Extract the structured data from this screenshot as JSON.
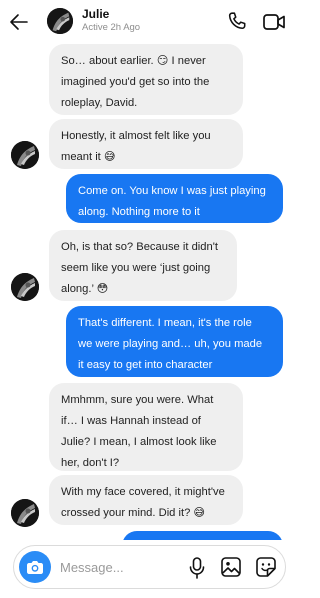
{
  "header": {
    "contact_name": "Julie",
    "status": "Active 2h Ago"
  },
  "messages": [
    {
      "sender": "Julie",
      "direction": "incoming",
      "lines": [
        "So… about earlier. 😏 I never",
        "imagined you'd get so into the",
        "roleplay, David."
      ]
    },
    {
      "sender": "Julie",
      "direction": "incoming",
      "lines": [
        "Honestly, it almost felt like you",
        "meant it 😅"
      ]
    },
    {
      "sender": "David",
      "direction": "outgoing",
      "lines": [
        "Come on. You know I was just playing",
        "along. Nothing more to it"
      ]
    },
    {
      "sender": "Julie",
      "direction": "incoming",
      "lines": [
        "Oh, is that so? Because it didn't",
        "seem like you were ‘just going",
        "along.’ 😳"
      ]
    },
    {
      "sender": "David",
      "direction": "outgoing",
      "lines": [
        "That's different. I mean, it's the role",
        "we were playing and… uh, you made",
        "it easy to get into character"
      ]
    },
    {
      "sender": "Julie",
      "direction": "incoming",
      "lines": [
        "Mmhmm, sure you were. What",
        "if… I was Hannah instead of",
        "Julie? I mean, I almost look like",
        "her, don't I?"
      ]
    },
    {
      "sender": "Julie",
      "direction": "incoming",
      "lines": [
        "With my face covered, it might've",
        "crossed your mind. Did it? 😅"
      ]
    }
  ],
  "composer": {
    "placeholder": "Message..."
  },
  "icons": {
    "back": "arrow-left-icon",
    "call": "phone-icon",
    "video": "video-camera-icon",
    "camera": "camera-icon",
    "mic": "microphone-icon",
    "gallery": "image-icon",
    "sticker": "sticker-icon"
  },
  "colors": {
    "outgoing_bubble": "#1877f2",
    "incoming_bubble": "#efefef",
    "camera_button": "#2a8cf6"
  }
}
